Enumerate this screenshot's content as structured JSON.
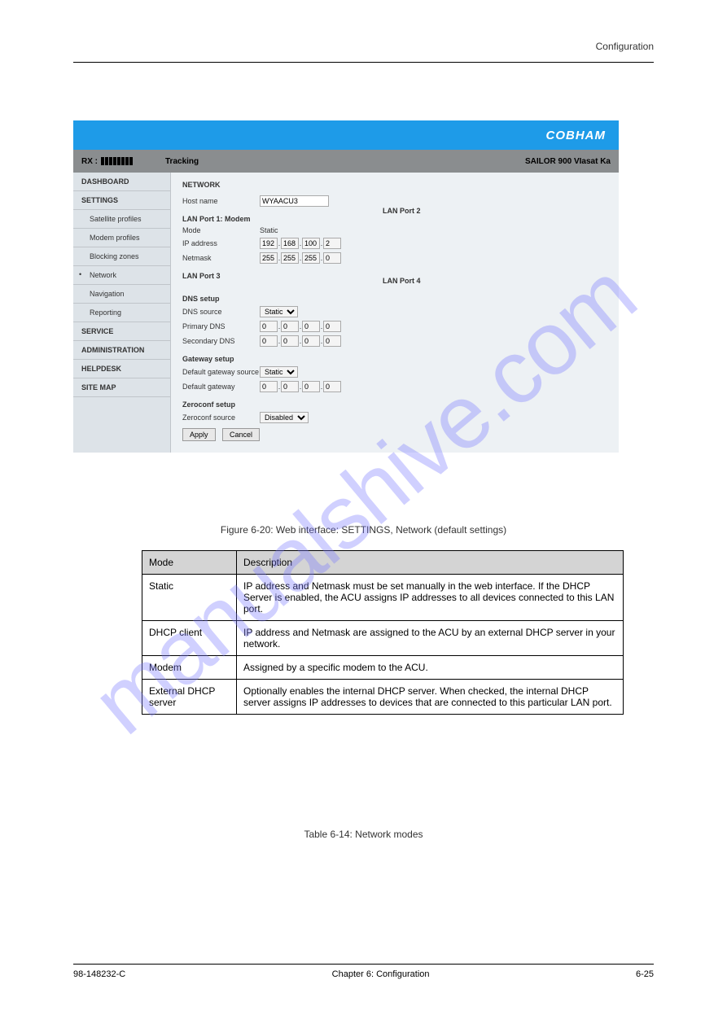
{
  "header": {
    "section_title": "Configuration"
  },
  "watermark": "manualshive.com",
  "screenshot": {
    "brand": "COBHAM",
    "statusbar": {
      "rx_label": "RX :",
      "tracking": "Tracking",
      "model": "SAILOR 900 VIasat Ka"
    },
    "nav": {
      "dashboard": "DASHBOARD",
      "settings": "SETTINGS",
      "satellite_profiles": "Satellite profiles",
      "modem_profiles": "Modem profiles",
      "blocking_zones": "Blocking zones",
      "network": "Network",
      "navigation": "Navigation",
      "reporting": "Reporting",
      "service": "SERVICE",
      "administration": "ADMINISTRATION",
      "helpdesk": "HELPDESK",
      "site_map": "SITE MAP"
    },
    "content": {
      "network_hdr": "NETWORK",
      "host_name_label": "Host name",
      "host_name_value": "WYAACU3",
      "lan1_hdr": "LAN Port 1: Modem",
      "lan2_hdr": "LAN Port 2",
      "lan3_hdr": "LAN Port 3",
      "lan4_hdr": "LAN Port 4",
      "mode_label": "Mode",
      "mode_value": "Static",
      "ip_label": "IP address",
      "ip": [
        "192",
        "168",
        "100",
        "2"
      ],
      "netmask_label": "Netmask",
      "netmask": [
        "255",
        "255",
        "255",
        "0"
      ],
      "dns_setup": "DNS setup",
      "dns_source_label": "DNS source",
      "dns_source": "Static",
      "primary_dns_label": "Primary DNS",
      "primary_dns": [
        "0",
        "0",
        "0",
        "0"
      ],
      "secondary_dns_label": "Secondary DNS",
      "secondary_dns": [
        "0",
        "0",
        "0",
        "0"
      ],
      "gateway_setup": "Gateway setup",
      "gw_source_label": "Default gateway source",
      "gw_source": "Static",
      "gw_label": "Default gateway",
      "gw": [
        "0",
        "0",
        "0",
        "0"
      ],
      "zeroconf_setup": "Zeroconf setup",
      "zeroconf_label": "Zeroconf source",
      "zeroconf": "Disabled",
      "apply": "Apply",
      "cancel": "Cancel"
    }
  },
  "figure_caption": "Figure 6-20:  Web interface: SETTINGS, Network (default settings)",
  "table": {
    "headers": [
      "Mode",
      "Description"
    ],
    "rows": [
      [
        "Static",
        "IP address and Netmask must be set manually in the web interface. If the DHCP Server is enabled, the ACU assigns IP addresses to all devices connected to this LAN port."
      ],
      [
        "DHCP client",
        "IP address and Netmask are assigned to the ACU by an external DHCP server in your network."
      ],
      [
        "Modem",
        "Assigned by a specific modem to the ACU."
      ],
      [
        "External DHCP server",
        "Optionally enables the internal DHCP server. When checked, the internal DHCP server assigns IP addresses to devices that are connected to this particular LAN port."
      ]
    ]
  },
  "table_caption": "Table 6-14:  Network modes",
  "footer": {
    "docno": "98-148232-C",
    "chapter": "Chapter 6: Configuration",
    "page": "6-25"
  }
}
